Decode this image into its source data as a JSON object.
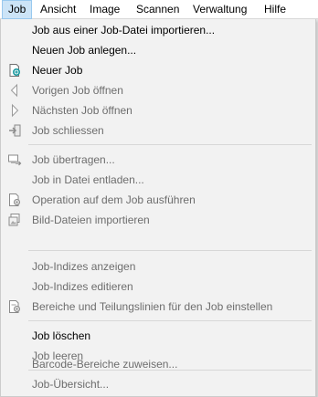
{
  "menubar": {
    "items": [
      "Job",
      "Ansicht",
      "Image",
      "Scannen",
      "Verwaltung",
      "Hilfe"
    ]
  },
  "menu": {
    "items": [
      {
        "label": "Job aus einer Job-Datei importieren...",
        "enabled": true,
        "icon": ""
      },
      {
        "label": "Neuen Job anlegen...",
        "enabled": true,
        "icon": ""
      },
      {
        "label": "Neuer Job",
        "enabled": true,
        "icon": "new-job-icon"
      },
      {
        "label": "Vorigen Job öffnen",
        "enabled": false,
        "icon": "previous-icon"
      },
      {
        "label": "Nächsten Job öffnen",
        "enabled": false,
        "icon": "next-icon"
      },
      {
        "label": "Job schliessen",
        "enabled": false,
        "icon": "close-job-icon"
      },
      {
        "label": "Job übertragen...",
        "enabled": false,
        "icon": "transfer-icon"
      },
      {
        "label": "Job in Datei entladen...",
        "enabled": false,
        "icon": ""
      },
      {
        "label": "Operation auf dem Job ausführen",
        "enabled": false,
        "icon": "operation-icon"
      },
      {
        "label": "Bild-Dateien importieren",
        "enabled": false,
        "icon": "import-images-icon"
      },
      {
        "label": "Job-Indizes anzeigen",
        "enabled": false,
        "icon": ""
      },
      {
        "label": "Job-Indizes editieren",
        "enabled": false,
        "icon": ""
      },
      {
        "label": "Bereiche und Teilungslinien für den Job einstellen",
        "enabled": false,
        "icon": "regions-icon"
      },
      {
        "label": "Job löschen",
        "enabled": true,
        "icon": ""
      },
      {
        "label": "Job leeren",
        "enabled": false,
        "icon": ""
      },
      {
        "label": "Barcode-Bereiche zuweisen...",
        "enabled": false,
        "icon": ""
      },
      {
        "label": "Job-Übersicht...",
        "enabled": false,
        "icon": ""
      }
    ]
  }
}
